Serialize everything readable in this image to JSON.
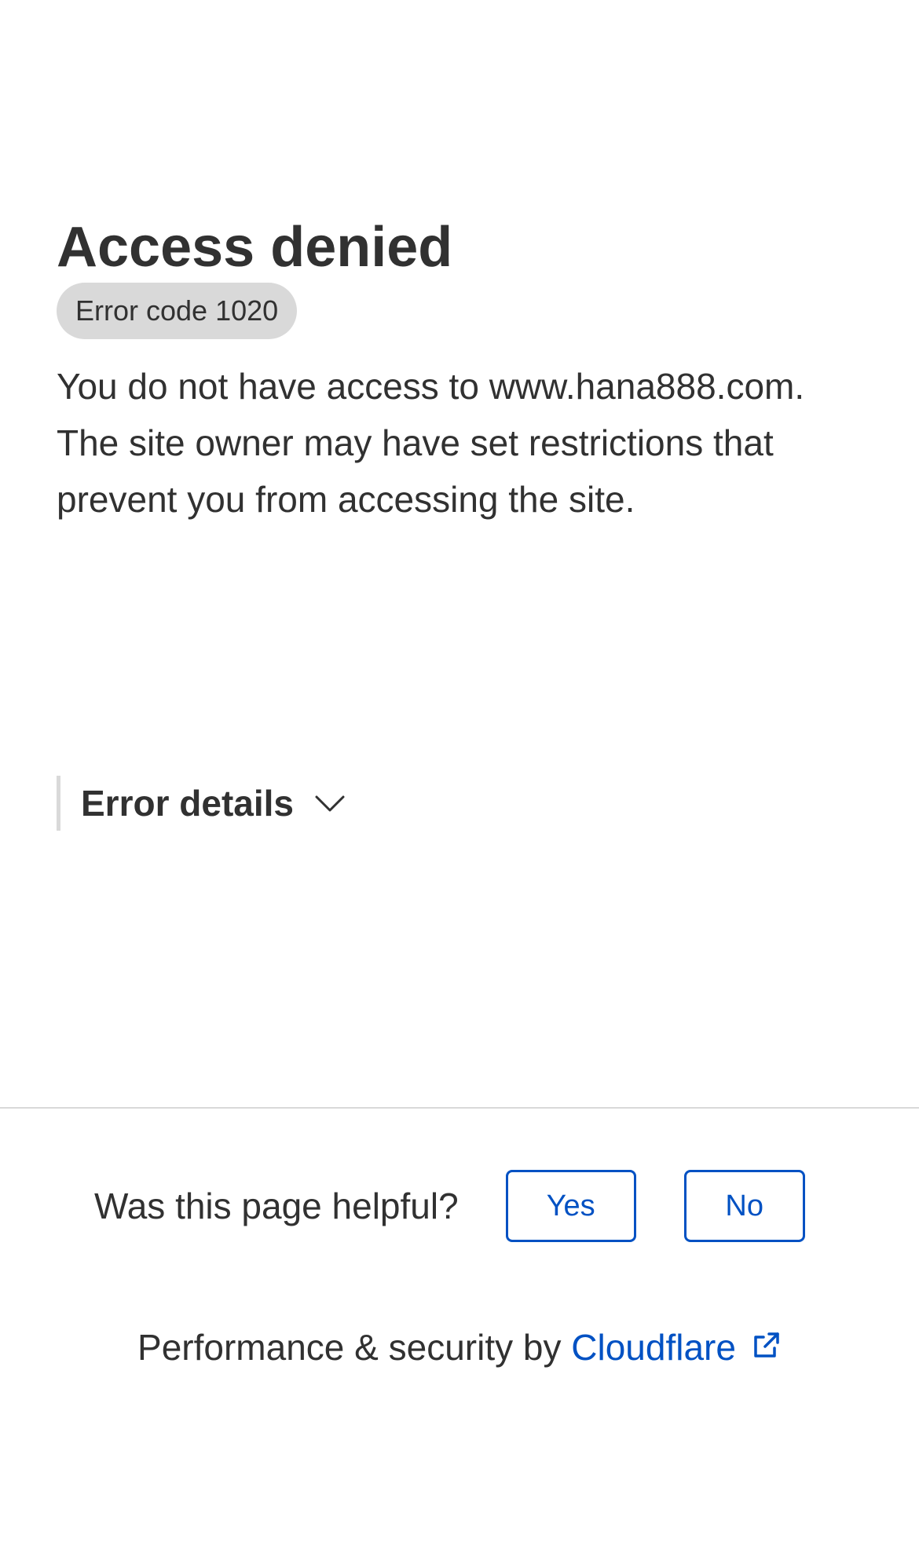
{
  "main": {
    "title": "Access denied",
    "error_code": "Error code 1020",
    "description": "You do not have access to www.hana888.com. The site owner may have set restrictions that prevent you from accessing the site."
  },
  "error_details": {
    "label": "Error details",
    "icon": "chevron-down-icon"
  },
  "feedback": {
    "question": "Was this page helpful?",
    "yes_label": "Yes",
    "no_label": "No"
  },
  "footer": {
    "prefix": "Performance & security by",
    "link_label": "Cloudflare",
    "icon": "external-link-icon"
  },
  "colors": {
    "text": "#313131",
    "badge_bg": "#d9d9d9",
    "accent": "#0051c3",
    "divider": "#d9d9d9"
  }
}
